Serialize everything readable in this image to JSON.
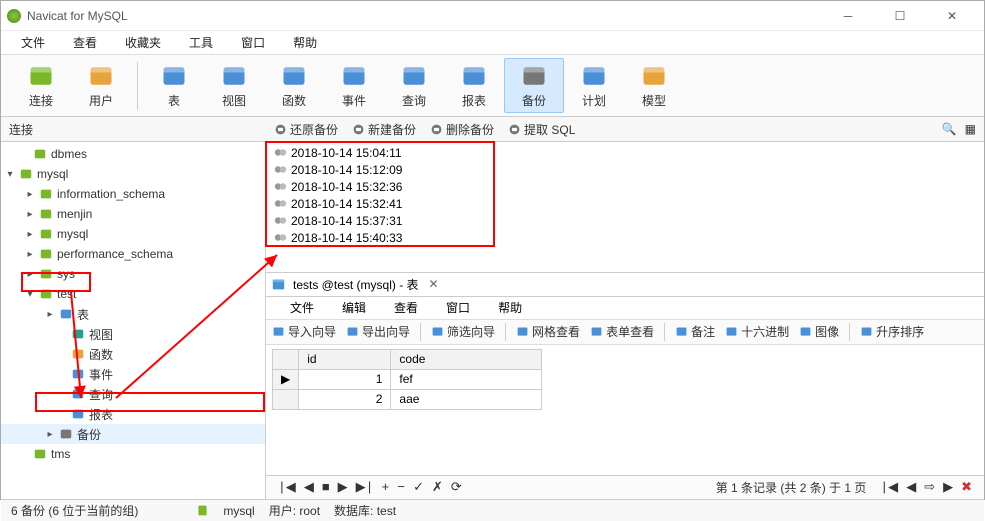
{
  "window": {
    "title": "Navicat for MySQL"
  },
  "menu": {
    "items": [
      "文件",
      "查看",
      "收藏夹",
      "工具",
      "窗口",
      "帮助"
    ]
  },
  "toolbar": {
    "groups": [
      [
        {
          "label": "连接",
          "name": "tool-connection"
        },
        {
          "label": "用户",
          "name": "tool-user"
        }
      ],
      [
        {
          "label": "表",
          "name": "tool-table"
        },
        {
          "label": "视图",
          "name": "tool-view"
        },
        {
          "label": "函数",
          "name": "tool-function"
        },
        {
          "label": "事件",
          "name": "tool-event"
        },
        {
          "label": "查询",
          "name": "tool-query"
        },
        {
          "label": "报表",
          "name": "tool-report"
        },
        {
          "label": "备份",
          "name": "tool-backup",
          "active": true
        },
        {
          "label": "计划",
          "name": "tool-schedule"
        },
        {
          "label": "模型",
          "name": "tool-model"
        }
      ]
    ]
  },
  "conn_label": "连接",
  "sub_actions": [
    {
      "label": "还原备份",
      "name": "action-restore"
    },
    {
      "label": "新建备份",
      "name": "action-new-backup"
    },
    {
      "label": "删除备份",
      "name": "action-delete-backup"
    },
    {
      "label": "提取 SQL",
      "name": "action-extract-sql"
    }
  ],
  "sidebar": {
    "items": [
      {
        "arrow": "",
        "indent": 18,
        "icon": "conn",
        "label": "dbmes",
        "name": "node-dbmes"
      },
      {
        "arrow": "▾",
        "indent": 4,
        "icon": "conn",
        "label": "mysql",
        "name": "node-mysql"
      },
      {
        "arrow": "▸",
        "indent": 24,
        "icon": "db",
        "label": "information_schema",
        "name": "node-infoschema"
      },
      {
        "arrow": "▸",
        "indent": 24,
        "icon": "db",
        "label": "menjin",
        "name": "node-menjin"
      },
      {
        "arrow": "▸",
        "indent": 24,
        "icon": "db",
        "label": "mysql",
        "name": "node-mysql-db"
      },
      {
        "arrow": "▸",
        "indent": 24,
        "icon": "db",
        "label": "performance_schema",
        "name": "node-perfschema"
      },
      {
        "arrow": "▸",
        "indent": 24,
        "icon": "db",
        "label": "sys",
        "name": "node-sys"
      },
      {
        "arrow": "▾",
        "indent": 24,
        "icon": "db",
        "label": "test",
        "name": "node-test"
      },
      {
        "arrow": "▸",
        "indent": 44,
        "icon": "tbl",
        "label": "表",
        "name": "node-tables"
      },
      {
        "arrow": "",
        "indent": 56,
        "icon": "vw",
        "label": "视图",
        "name": "node-views"
      },
      {
        "arrow": "",
        "indent": 56,
        "icon": "fn",
        "label": "函数",
        "name": "node-functions"
      },
      {
        "arrow": "",
        "indent": 56,
        "icon": "ev",
        "label": "事件",
        "name": "node-events"
      },
      {
        "arrow": "",
        "indent": 56,
        "icon": "qr",
        "label": "查询",
        "name": "node-queries"
      },
      {
        "arrow": "",
        "indent": 56,
        "icon": "rp",
        "label": "报表",
        "name": "node-reports"
      },
      {
        "arrow": "▸",
        "indent": 44,
        "icon": "bk",
        "label": "备份",
        "name": "node-backup",
        "selected": true
      },
      {
        "arrow": "",
        "indent": 18,
        "icon": "conn",
        "label": "tms",
        "name": "node-tms"
      }
    ]
  },
  "backups": [
    {
      "ts": "2018-10-14 15:04:11"
    },
    {
      "ts": "2018-10-14 15:12:09"
    },
    {
      "ts": "2018-10-14 15:32:36"
    },
    {
      "ts": "2018-10-14 15:32:41"
    },
    {
      "ts": "2018-10-14 15:37:31"
    },
    {
      "ts": "2018-10-14 15:40:33"
    }
  ],
  "tab": {
    "title": "tests @test (mysql) - 表",
    "menu": [
      "文件",
      "编辑",
      "查看",
      "窗口",
      "帮助"
    ],
    "tools": [
      {
        "label": "导入向导",
        "name": "tb-import"
      },
      {
        "label": "导出向导",
        "name": "tb-export"
      },
      {
        "label": "筛选向导",
        "name": "tb-filter"
      },
      {
        "label": "网格查看",
        "name": "tb-grid"
      },
      {
        "label": "表单查看",
        "name": "tb-form"
      },
      {
        "label": "备注",
        "name": "tb-memo"
      },
      {
        "label": "十六进制",
        "name": "tb-hex"
      },
      {
        "label": "图像",
        "name": "tb-image"
      },
      {
        "label": "升序排序",
        "name": "tb-sort-asc"
      }
    ],
    "columns": [
      "id",
      "code"
    ],
    "rows": [
      {
        "marker": "▶",
        "id": "1",
        "code": "fef"
      },
      {
        "marker": "",
        "id": "2",
        "code": "aae"
      }
    ],
    "record_info": "第 1 条记录 (共 2 条) 于 1 页"
  },
  "status": {
    "left": "6 备份 (6 位于当前的组)",
    "conn": "mysql",
    "user": "用户: root",
    "db": "数据库: test"
  }
}
